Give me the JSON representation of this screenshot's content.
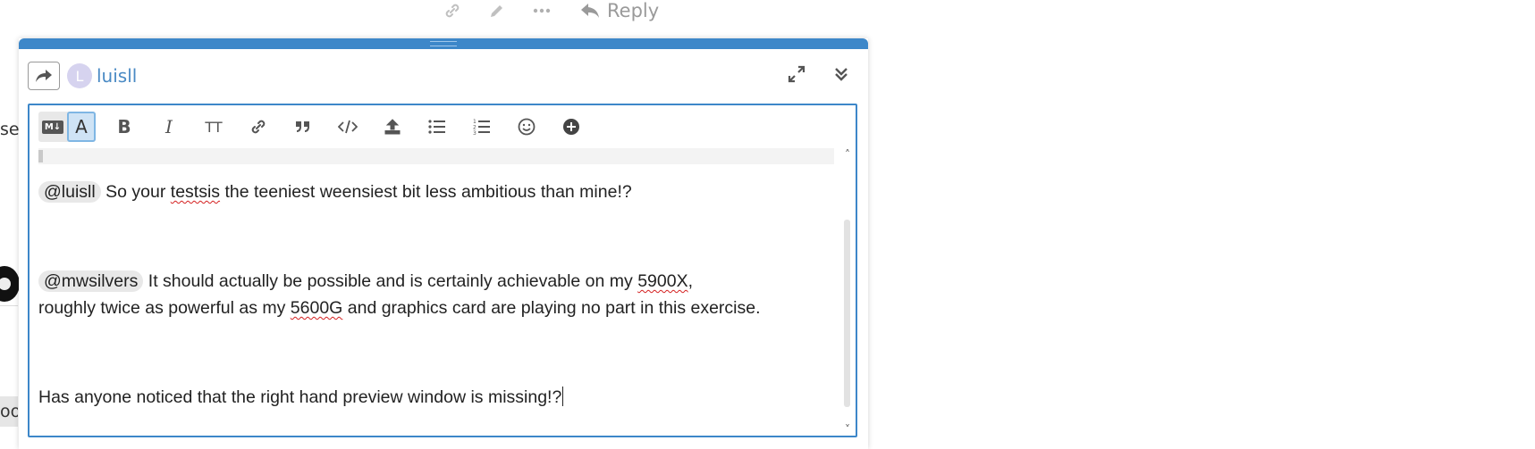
{
  "post_actions": {
    "reply_label": "Reply",
    "icons": [
      "link-icon",
      "pencil-icon",
      "ellipsis-icon",
      "reply-arrow-icon"
    ]
  },
  "background": {
    "fragment_text": "se",
    "chip_text": "oo"
  },
  "composer": {
    "accent_color": "#3d87c9",
    "user": {
      "avatar_letter": "L",
      "name": "luisll"
    },
    "toolbar": {
      "mode_markdown_label": "M↓",
      "mode_rich_label": "A",
      "bold_label": "B",
      "italic_label": "I",
      "heading_label": "TT",
      "icons": [
        "link-icon",
        "quote-icon",
        "code-icon",
        "upload-icon",
        "bullet-list-icon",
        "numbered-list-icon",
        "emoji-icon",
        "plus-circle-icon"
      ]
    },
    "body": {
      "p1_mention": "@luisll",
      "p1_a": " So your ",
      "p1_misspelled": "testsis",
      "p1_b": " the teeniest weensiest bit less ambitious than mine!?",
      "p2_mention": "@mwsilvers",
      "p2_a": " It should actually be possible and is certainly achievable on my ",
      "p2_cpu1": "5900X",
      "p2_b": ",",
      "p2_c": "roughly twice as powerful as my ",
      "p2_cpu2": "5600G",
      "p2_d": " and graphics card are playing no part in this exercise.",
      "p3": "Has anyone noticed that the right hand preview window is missing!?"
    }
  }
}
